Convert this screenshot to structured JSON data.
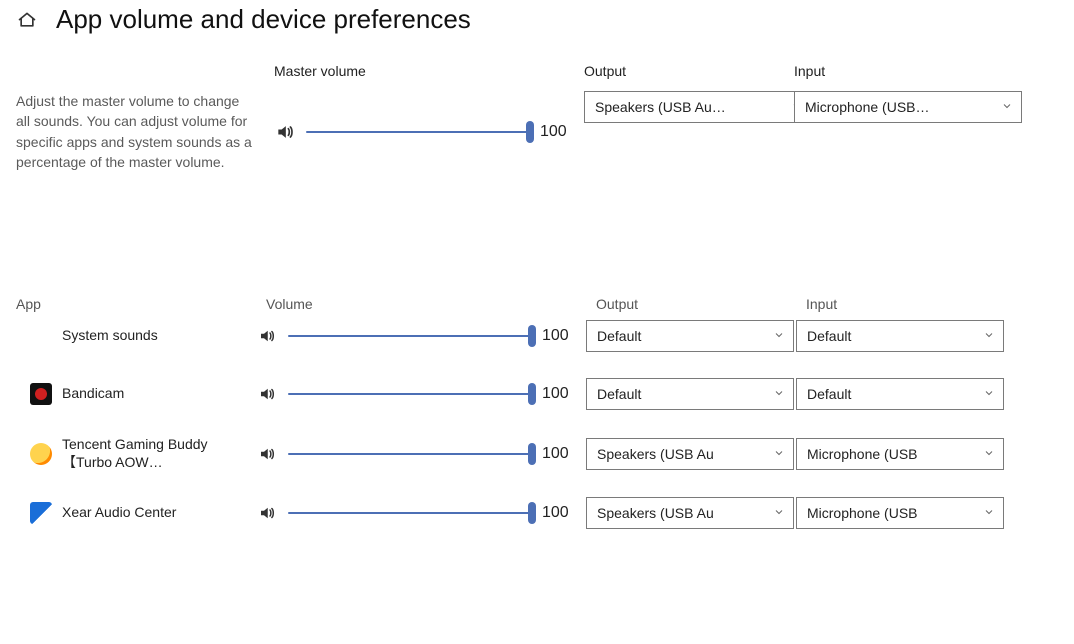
{
  "header": {
    "title": "App volume and device preferences"
  },
  "master": {
    "desc": "Adjust the master volume to change all sounds. You can adjust volume for specific apps and system sounds as a percentage of the master volume.",
    "volume_label": "Master volume",
    "volume_value": "100",
    "output_label": "Output",
    "output_selected": "Speakers (USB Au…",
    "input_label": "Input",
    "input_selected": "Microphone (USB…"
  },
  "app_section": {
    "col_app": "App",
    "col_volume": "Volume",
    "col_output": "Output",
    "col_input": "Input"
  },
  "apps": [
    {
      "name": "System sounds",
      "icon": "system",
      "volume": "100",
      "output": "Default",
      "input": "Default"
    },
    {
      "name": "Bandicam",
      "icon": "bandicam",
      "volume": "100",
      "output": "Default",
      "input": "Default"
    },
    {
      "name": "Tencent Gaming Buddy【Turbo AOW…",
      "icon": "tencent",
      "volume": "100",
      "output": "Speakers (USB Au",
      "input": "Microphone (USB"
    },
    {
      "name": "Xear Audio Center",
      "icon": "xear",
      "volume": "100",
      "output": "Speakers (USB Au",
      "input": "Microphone (USB"
    }
  ]
}
